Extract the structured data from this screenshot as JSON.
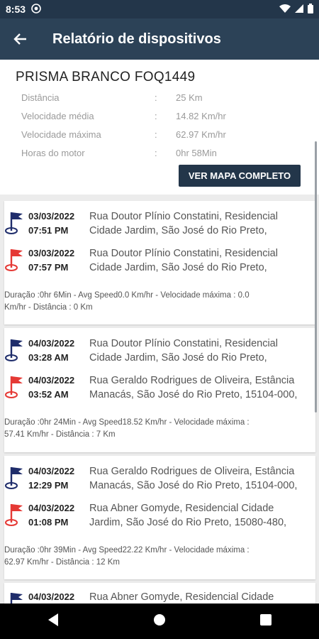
{
  "status": {
    "time": "8:53"
  },
  "appbar": {
    "title": "Relatório de dispositivos"
  },
  "summary": {
    "device": "PRISMA BRANCO FOQ1449",
    "rows": [
      {
        "label": "Distância",
        "value": "25 Km"
      },
      {
        "label": "Velocidade média",
        "value": "14.82 Km/hr"
      },
      {
        "label": "Velocidade máxima",
        "value": "62.97 Km/hr"
      },
      {
        "label": "Horas do motor",
        "value": "0hr 58Min"
      }
    ],
    "colon": ":",
    "map_button": "VER MAPA COMPLETO"
  },
  "trips": [
    {
      "start": {
        "date": "03/03/2022",
        "time": "07:51 PM",
        "addr1": "Rua Doutor Plínio Constatini, Residencial",
        "addr2": "Cidade Jardim, São José do Rio Preto,"
      },
      "end": {
        "date": "03/03/2022",
        "time": "07:57 PM",
        "addr1": "Rua Doutor Plínio Constatini, Residencial",
        "addr2": "Cidade Jardim, São José do Rio Preto,"
      },
      "info1": "Duração :0hr 6Min - Avg Speed0.0 Km/hr - Velocidade máxima : 0.0",
      "info2": "Km/hr - Distância : 0 Km"
    },
    {
      "start": {
        "date": "04/03/2022",
        "time": "03:28 AM",
        "addr1": "Rua Doutor Plínio Constatini, Residencial",
        "addr2": "Cidade Jardim, São José do Rio Preto,"
      },
      "end": {
        "date": "04/03/2022",
        "time": "03:52 AM",
        "addr1": "Rua Geraldo Rodrigues de Oliveira, Estância",
        "addr2": "Manacás, São José do Rio Preto, 15104-000,"
      },
      "info1": "Duração :0hr 24Min - Avg Speed18.52 Km/hr - Velocidade máxima :",
      "info2": "57.41 Km/hr - Distância : 7 Km"
    },
    {
      "start": {
        "date": "04/03/2022",
        "time": "12:29 PM",
        "addr1": "Rua Geraldo Rodrigues de Oliveira, Estância",
        "addr2": "Manacás, São José do Rio Preto, 15104-000,"
      },
      "end": {
        "date": "04/03/2022",
        "time": "01:08 PM",
        "addr1": "Rua Abner Gomyde, Residencial Cidade",
        "addr2": "Jardim, São José do Rio Preto, 15080-480,"
      },
      "info1": "Duração :0hr 39Min - Avg Speed22.22 Km/hr - Velocidade máxima :",
      "info2": "62.97 Km/hr - Distância : 12 Km"
    },
    {
      "start": {
        "date": "04/03/2022",
        "time": "",
        "addr1": "Rua Abner Gomyde, Residencial Cidade",
        "addr2": ""
      }
    }
  ],
  "colors": {
    "appbar": "#2c4257",
    "start_flag": "#1f2d6b",
    "end_flag": "#e53935"
  }
}
